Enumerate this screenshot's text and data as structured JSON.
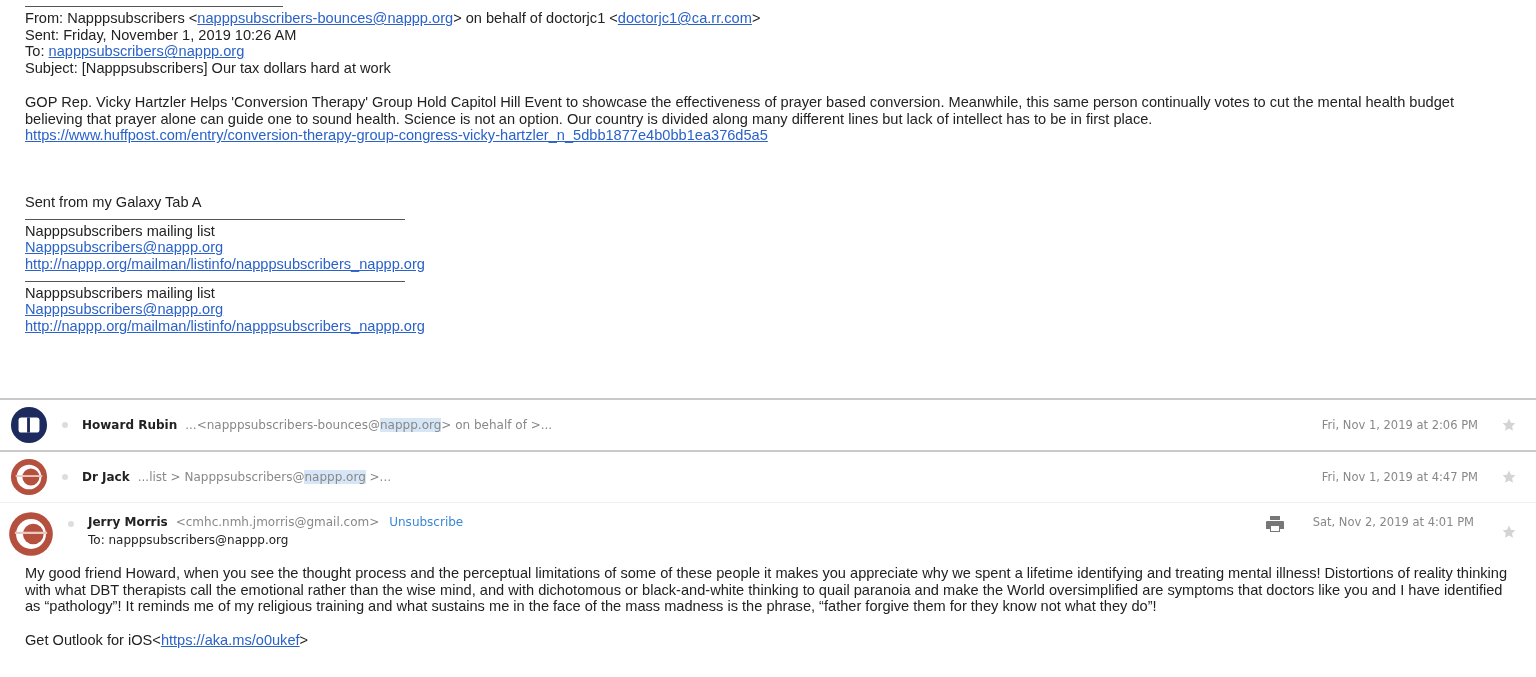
{
  "quoted_message": {
    "header_lines": [
      [
        {
          "kind": "text",
          "text": "From: Napppsubscribers <"
        },
        {
          "kind": "link",
          "text": "napppsubscribers-bounces@nappp.org"
        },
        {
          "kind": "text",
          "text": "> on behalf of doctorjc1 <"
        },
        {
          "kind": "link",
          "text": "doctorjc1@ca.rr.com"
        },
        {
          "kind": "text",
          "text": ">"
        }
      ],
      [
        {
          "kind": "text",
          "text": "Sent: Friday, November 1, 2019 10:26 AM"
        }
      ],
      [
        {
          "kind": "text",
          "text": "To: "
        },
        {
          "kind": "link",
          "text": "napppsubscribers@nappp.org"
        }
      ],
      [
        {
          "kind": "text",
          "text": "Subject: [Napppsubscribers] Our tax dollars hard at work"
        }
      ]
    ],
    "body": "GOP Rep. Vicky Hartzler Helps 'Conversion Therapy' Group Hold Capitol Hill Event to showcase the effectiveness of prayer based conversion. Meanwhile, this same person continually votes to cut the mental health budget believing that prayer alone can guide one to sound health. Science is not an option. Our country is divided along many different lines but lack of intellect has to be in first place.",
    "link": "https://www.huffpost.com/entry/conversion-therapy-group-congress-vicky-hartzler_n_5dbb1877e4b0bb1ea376d5a5",
    "signature": "Sent from my Galaxy Tab A",
    "footers": [
      {
        "title": "Napppsubscribers mailing list",
        "email": "Napppsubscribers@nappp.org",
        "url": "http://nappp.org/mailman/listinfo/napppsubscribers_nappp.org"
      },
      {
        "title": "Napppsubscribers mailing list",
        "email": "Napppsubscribers@nappp.org",
        "url": "http://nappp.org/mailman/listinfo/napppsubscribers_nappp.org"
      }
    ]
  },
  "thread": [
    {
      "sender": "Howard Rubin",
      "color": "#1c2a5e",
      "expanded": false,
      "snippet": [
        {
          "text": "...<napppsubscribers-bounces@",
          "highlighted": false
        },
        {
          "text": "nappp.org",
          "highlighted": true
        },
        {
          "text": "> on behalf of >...",
          "highlighted": false
        }
      ],
      "date": "Fri, Nov 1, 2019 at 2:06 PM"
    },
    {
      "sender": "Dr Jack",
      "color": "#b5503f",
      "expanded": false,
      "snippet": [
        {
          "text": "...list > Napppsubscribers@",
          "highlighted": false
        },
        {
          "text": "nappp.org",
          "highlighted": true
        },
        {
          "text": " >...",
          "highlighted": false
        }
      ],
      "date": "Fri, Nov 1, 2019 at 4:47 PM"
    },
    {
      "sender": "Jerry Morris",
      "color": "#b5503f",
      "expanded": true,
      "email": "<cmhc.nmh.jmorris@gmail.com>",
      "unsubscribe": "Unsubscribe",
      "to": "To: napppsubscribers@nappp.org",
      "date": "Sat, Nov 2, 2019 at 4:01 PM",
      "body": "My good friend Howard, when you see the thought process and the perceptual limitations of some of these people it makes you appreciate why we spent a lifetime identifying and treating mental illness! Distortions of reality thinking with what DBT therapists call the emotional rather than the wise mind, and with dichotomous or black-and-white thinking to quail paranoia and make the World oversimplified are symptoms that doctors like you and I have identified as “pathology”! It reminds me of my religious training and what sustains me in the face of the mass madness is the phrase, “father forgive them for they know not what they do”!",
      "outlook_prefix": "Get Outlook for iOS<",
      "outlook_link": "https://aka.ms/o0ukef",
      "outlook_suffix": ">"
    }
  ]
}
